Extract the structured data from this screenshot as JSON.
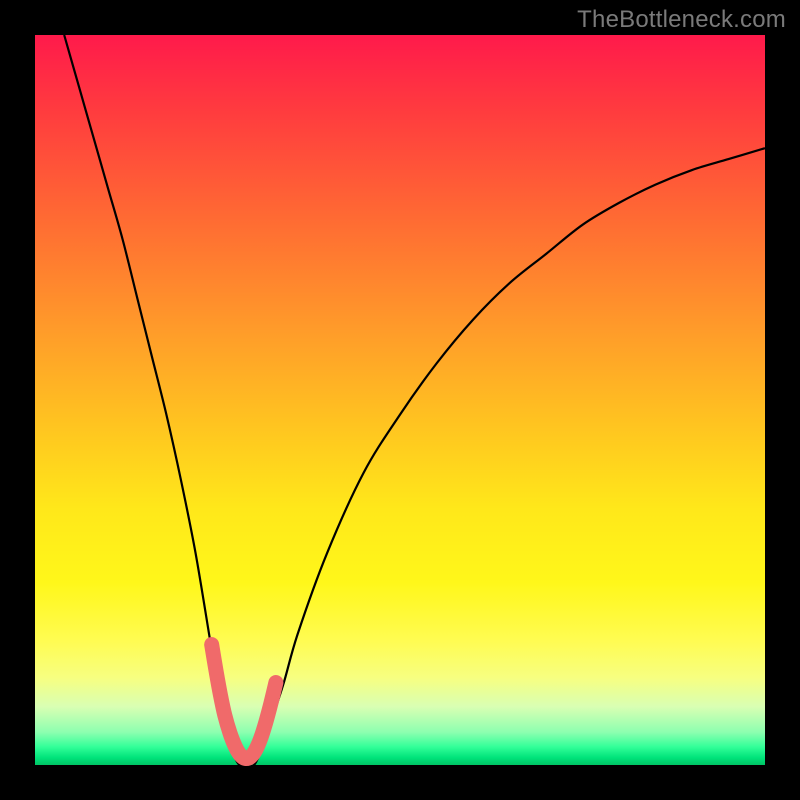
{
  "watermark": "TheBottleneck.com",
  "colors": {
    "curve_stroke": "#000000",
    "marker_stroke": "#f06a6a",
    "background_black": "#000000"
  },
  "chart_data": {
    "type": "line",
    "title": "",
    "xlabel": "",
    "ylabel": "",
    "xlim": [
      0,
      100
    ],
    "ylim": [
      0,
      100
    ],
    "series": [
      {
        "name": "bottleneck-curve",
        "x": [
          4,
          6,
          8,
          10,
          12,
          14,
          16,
          18,
          20,
          22,
          24,
          25,
          26,
          27,
          28,
          29,
          30,
          31,
          32,
          34,
          36,
          40,
          45,
          50,
          55,
          60,
          65,
          70,
          75,
          80,
          85,
          90,
          95,
          100
        ],
        "y": [
          100,
          93,
          86,
          79,
          72,
          64,
          56,
          48,
          39,
          29,
          17,
          11,
          6,
          2,
          0,
          0,
          0,
          2,
          5,
          11,
          18,
          29,
          40,
          48,
          55,
          61,
          66,
          70,
          74,
          77,
          79.5,
          81.5,
          83,
          84.5
        ]
      }
    ],
    "highlight_segment": {
      "name": "minimum-marker",
      "x": [
        24.2,
        24.8,
        25.4,
        26.0,
        26.7,
        27.4,
        28.1,
        28.8,
        29.5,
        30.2,
        30.9,
        31.6,
        32.3,
        33.0
      ],
      "y": [
        16.5,
        12.9,
        9.6,
        6.8,
        4.4,
        2.6,
        1.4,
        0.9,
        1.1,
        2.0,
        3.6,
        5.8,
        8.4,
        11.3
      ]
    }
  }
}
